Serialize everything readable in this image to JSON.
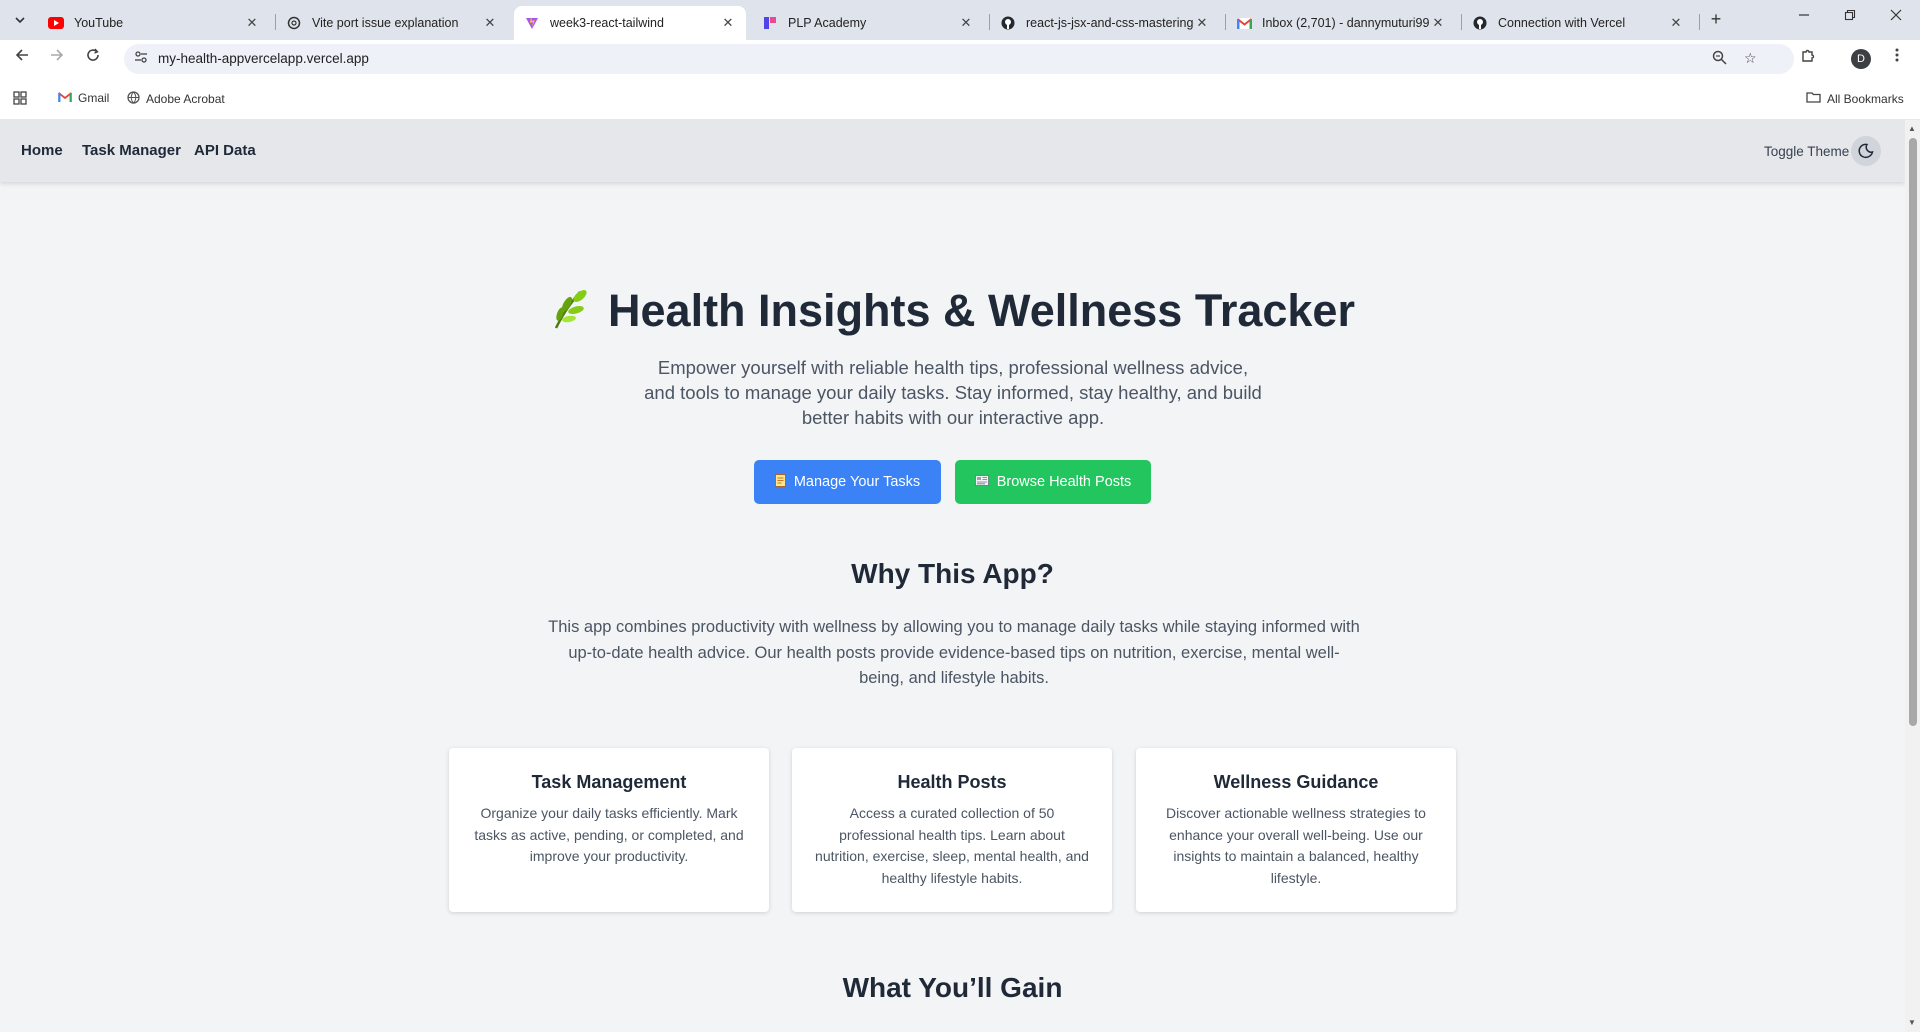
{
  "browser": {
    "tabs": [
      {
        "title": "YouTube",
        "icon": "youtube-icon",
        "active": false
      },
      {
        "title": "Vite port issue explanation",
        "icon": "chatgpt-icon",
        "active": false
      },
      {
        "title": "week3-react-tailwind",
        "icon": "vite-icon",
        "active": true
      },
      {
        "title": "PLP Academy",
        "icon": "plp-icon",
        "active": false
      },
      {
        "title": "react-js-jsx-and-css-mastering-",
        "icon": "github-icon",
        "active": false
      },
      {
        "title": "Inbox (2,701) - dannymuturi99",
        "icon": "gmail-icon",
        "active": false
      },
      {
        "title": "Connection with Vercel",
        "icon": "github-icon",
        "active": false
      }
    ],
    "url": "my-health-appvercelapp.vercel.app",
    "profile_initial": "D",
    "bookmarks": [
      {
        "label": "Gmail",
        "icon": "gmail-icon"
      },
      {
        "label": "Adobe Acrobat",
        "icon": "globe-icon"
      }
    ],
    "all_bookmarks": "All Bookmarks"
  },
  "nav": {
    "links": [
      "Home",
      "Task Manager",
      "API Data"
    ],
    "toggle_label": "Toggle Theme"
  },
  "hero": {
    "title": "Health Insights & Wellness Tracker",
    "subtitle": "Empower yourself with reliable health tips, professional wellness advice, and tools to manage your daily tasks. Stay informed, stay healthy, and build better habits with our interactive app.",
    "btn_tasks": "Manage Your Tasks",
    "btn_posts": "Browse Health Posts"
  },
  "why": {
    "heading": "Why This App?",
    "text": "This app combines productivity with wellness by allowing you to manage daily tasks while staying informed with up-to-date health advice. Our health posts provide evidence-based tips on nutrition, exercise, mental well-being, and lifestyle habits."
  },
  "cards": [
    {
      "title": "Task Management",
      "body": "Organize your daily tasks efficiently. Mark tasks as active, pending, or completed, and improve your productivity."
    },
    {
      "title": "Health Posts",
      "body": "Access a curated collection of 50 professional health tips. Learn about nutrition, exercise, sleep, mental health, and healthy lifestyle habits."
    },
    {
      "title": "Wellness Guidance",
      "body": "Discover actionable wellness strategies to enhance your overall well-being. Use our insights to maintain a balanced, healthy lifestyle."
    }
  ],
  "gain": {
    "heading": "What You’ll Gain"
  },
  "colors": {
    "blue_button": "#3b82f6",
    "green_button": "#22c55e",
    "nav_bg": "#e5e7eb",
    "page_bg": "#f3f4f6"
  }
}
